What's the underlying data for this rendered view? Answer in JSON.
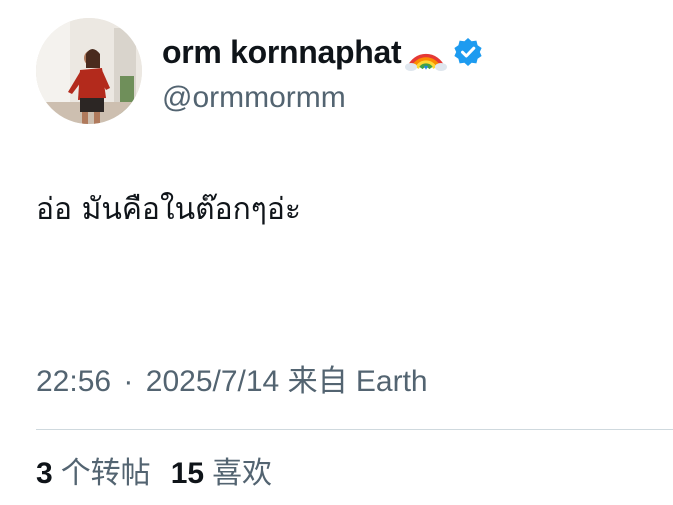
{
  "author": {
    "display_name": "orm kornnaphat",
    "name_emoji": "rainbow-emoji",
    "verified_badge": "verified-badge-icon",
    "handle": "@ormmormm",
    "avatar": "profile-photo"
  },
  "tweet": {
    "text": "อ่อ มันคือในต๊อกๆอ่ะ"
  },
  "meta": {
    "time": "22:56",
    "separator": "·",
    "date": "2025/7/14",
    "source": "来自 Earth"
  },
  "stats": {
    "reposts_count": "3",
    "reposts_label": "个转帖",
    "likes_count": "15",
    "likes_label": "喜欢"
  },
  "colors": {
    "text_primary": "#0f1419",
    "text_secondary": "#536471",
    "verified_blue": "#1d9bf0",
    "divider": "#cfd9de"
  }
}
